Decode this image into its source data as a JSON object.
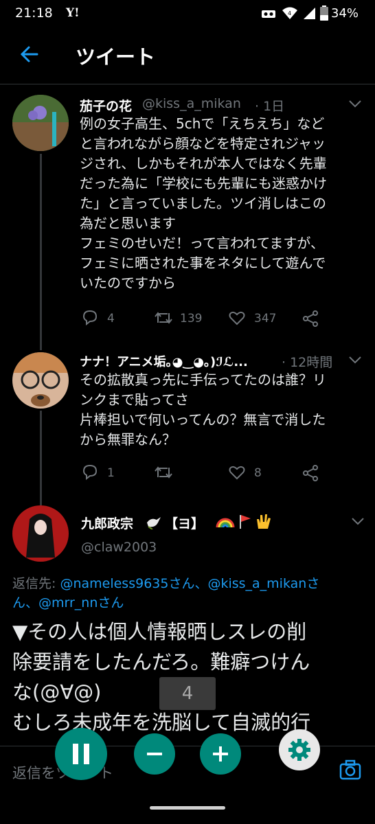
{
  "status_bar": {
    "time": "21:18",
    "carrier_logo": "Y!",
    "battery": "34%"
  },
  "header": {
    "title": "ツイート"
  },
  "tweets": [
    {
      "name": "茄子の花",
      "handle": "@kiss_a_mikan",
      "time": "· 1日",
      "lines": [
        "例の女子高生、5chで「えちえち」など",
        "と言われながら顔などを特定されジャッ",
        "ジされ、しかもそれが本人ではなく先輩",
        "だった為に「学校にも先輩にも迷惑かけ",
        "た」と言っていました。ツイ消しはこの",
        "為だと思います",
        "フェミのせいだ！って言われてますが、",
        "フェミに晒された事をネタにして遊んで",
        "いたのですから"
      ],
      "replies": "4",
      "retweets": "139",
      "likes": "347"
    },
    {
      "name": "ナナ！アニメ垢｡◕‿◕｡)ℐℒ...",
      "time": "· 12時間",
      "lines": [
        "その拡散真っ先に手伝ってたのは誰？リ",
        "ンクまで貼ってさ",
        "片棒担いで何いってんの？無言で消した",
        "から無罪なん？"
      ],
      "replies": "1",
      "retweets": "",
      "likes": "8"
    }
  ],
  "focused_tweet": {
    "name": "九郎政宗",
    "badges": "【ヨ】",
    "handle": "@claw2003",
    "reply_to_label": "返信先:",
    "reply_to_1": "@nameless9635さん、@kiss_a_mikanさ",
    "reply_to_2": "ん、@mrr_nnさん",
    "lines": [
      "▼その人は個人情報晒しスレの削",
      "除要請をしたんだろ。難癖つけん",
      "な(@∀@)",
      "むしろ未成年を洗脳して自滅的行"
    ]
  },
  "overlay": {
    "page_number": "4"
  },
  "composer": {
    "placeholder": "返信をツイート"
  }
}
